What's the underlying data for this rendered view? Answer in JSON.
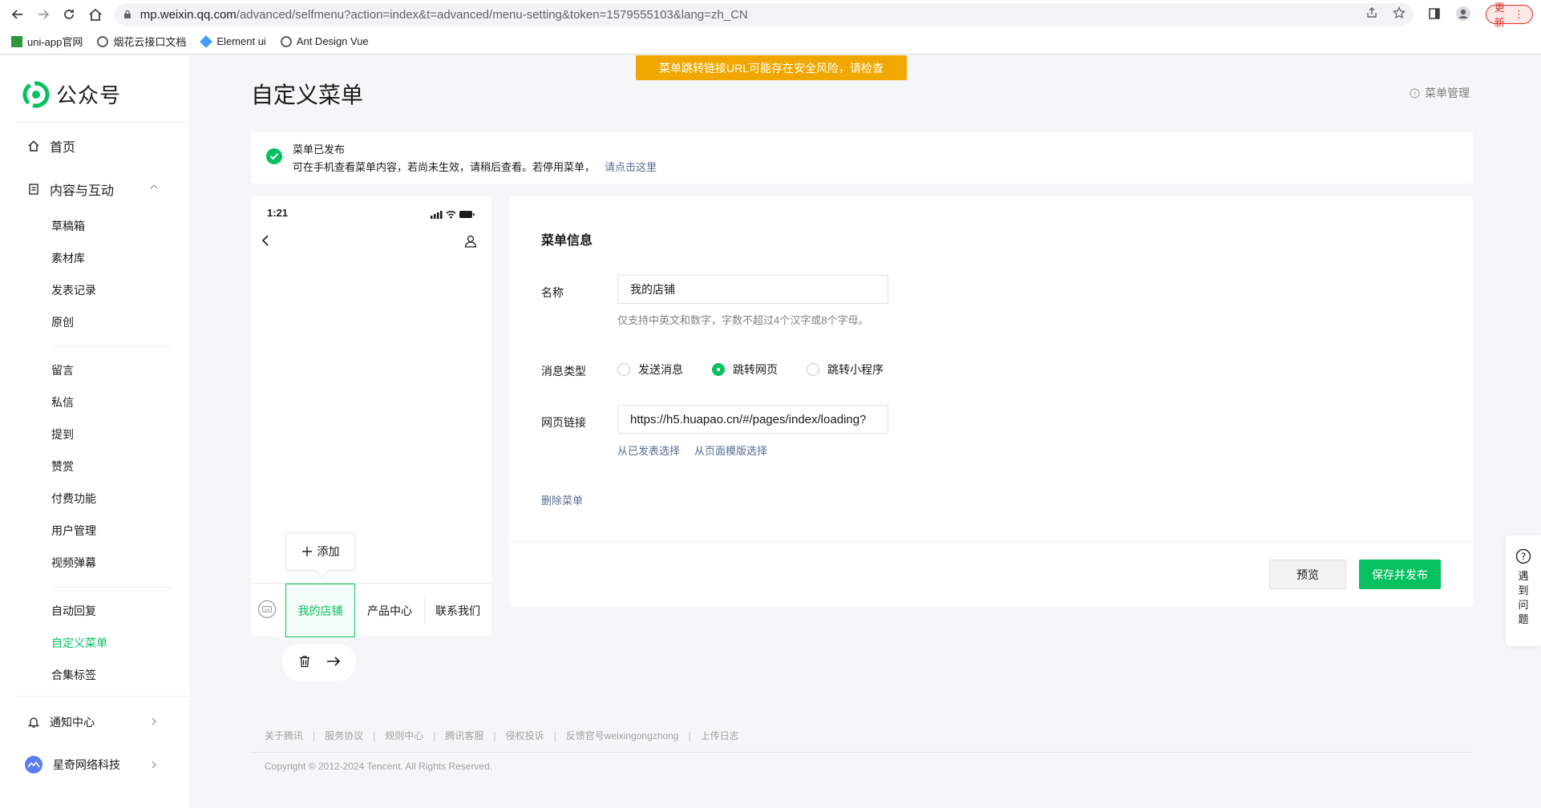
{
  "browser": {
    "url_host": "mp.weixin.qq.com",
    "url_rest": "/advanced/selfmenu?action=index&t=advanced/menu-setting&token=1579555103&lang=zh_CN",
    "update_label": "更新",
    "bookmarks": [
      "uni-app官网",
      "烟花云接口文档",
      "Element ui",
      "Ant Design Vue"
    ]
  },
  "sidebar": {
    "brand": "公众号",
    "home": "首页",
    "content_group": "内容与互动",
    "sub_items": [
      "草稿箱",
      "素材库",
      "发表记录",
      "原创",
      "留言",
      "私信",
      "提到",
      "赞赏",
      "付费功能",
      "用户管理",
      "视频弹幕",
      "自动回复",
      "自定义菜单",
      "合集标签"
    ],
    "notice_center": "通知中心",
    "account_name": "星奇网络科技"
  },
  "header": {
    "title": "自定义菜单",
    "warning_banner": "菜单跳转链接URL可能存在安全风险，请检查",
    "menu_management": "菜单管理"
  },
  "notice": {
    "title": "菜单已发布",
    "desc": "可在手机查看菜单内容，若尚未生效，请稍后查看。若停用菜单，",
    "link": "请点击这里"
  },
  "phone": {
    "time": "1:21",
    "add_label": "添加",
    "menu_items": [
      "我的店铺",
      "产品中心",
      "联系我们"
    ]
  },
  "form": {
    "section_title": "菜单信息",
    "name_label": "名称",
    "name_value": "我的店铺",
    "name_hint": "仅支持中英文和数字，字数不超过4个汉字或8个字母。",
    "type_label": "消息类型",
    "type_options": [
      "发送消息",
      "跳转网页",
      "跳转小程序"
    ],
    "type_selected": "跳转网页",
    "url_label": "网页链接",
    "url_value": "https://h5.huapao.cn/#/pages/index/loading?",
    "pick_published": "从已发表选择",
    "pick_template": "从页面模版选择",
    "delete_menu": "删除菜单",
    "preview_btn": "预览",
    "save_btn": "保存并发布"
  },
  "footer": {
    "links": [
      "关于腾讯",
      "服务协议",
      "规则中心",
      "腾讯客服",
      "侵权投诉",
      "反馈官号weixingongzhong",
      "上传日志"
    ],
    "copyright": "Copyright © 2012-2024 Tencent. All Rights Reserved."
  },
  "help": {
    "label": "遇到问题"
  },
  "colors": {
    "accent": "#07c160",
    "link": "#576b95",
    "warning": "#f0a800"
  }
}
